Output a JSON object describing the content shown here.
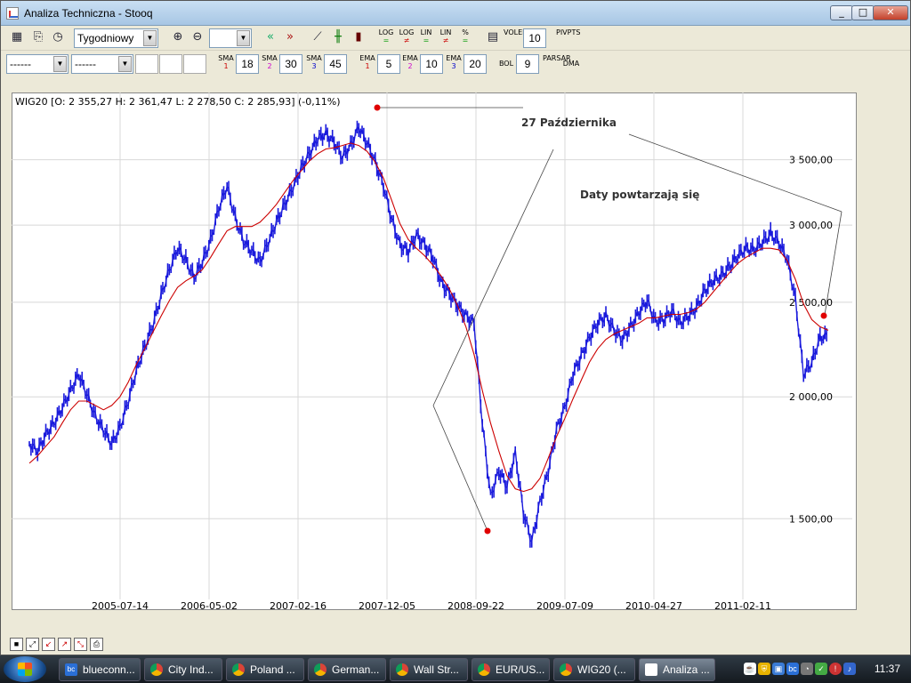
{
  "window": {
    "title": "Analiza Techniczna - Stooq",
    "min": "_",
    "max": "□",
    "close": "✕"
  },
  "toolbar1": {
    "interval": "Tygodniowy",
    "zoom_value": "",
    "vol_ema_label": [
      "VOL",
      "EMA"
    ],
    "vol_ema_value": "10",
    "piv_label": [
      "PIV",
      "PTS"
    ],
    "log_labels": [
      [
        "LOG",
        "="
      ],
      [
        "LOG",
        "≠"
      ],
      [
        "LIN",
        "="
      ],
      [
        "LIN",
        "≠"
      ],
      [
        "%",
        "="
      ]
    ]
  },
  "toolbar2": {
    "select1": "------",
    "select2": "------",
    "sma": [
      {
        "n": "1",
        "value": "18"
      },
      {
        "n": "2",
        "value": "30"
      },
      {
        "n": "3",
        "value": "45"
      }
    ],
    "ema": [
      {
        "n": "1",
        "value": "5"
      },
      {
        "n": "2",
        "value": "10"
      },
      {
        "n": "3",
        "value": "20"
      }
    ],
    "bol_label": "BOL",
    "bol_value": "9",
    "par_sar": [
      "PAR",
      "SAR"
    ],
    "dma": "DMA"
  },
  "chart_header": "WIG20 [O: 2 355,27  H: 2 361,47  L: 2 278,50  C: 2 285,93] (-0,11%)",
  "annotations": {
    "date_label": "27  Października",
    "note": "Daty powtarzają się"
  },
  "colors": {
    "price": "#1a1adc",
    "sma": "#cc0000",
    "marker": "#e00000",
    "grid": "#d8d8d8"
  },
  "chart_data": {
    "type": "line",
    "title": "WIG20 [O: 2 355,27  H: 2 361,47  L: 2 278,50  C: 2 285,93] (-0,11%)",
    "xlabel": "",
    "ylabel": "",
    "scale": "log",
    "ylim": [
      1240,
      4000
    ],
    "yticks": [
      1500,
      2000,
      2500,
      3000,
      3500
    ],
    "ytick_labels": [
      "1 500,00",
      "2 000,00",
      "2 500,00",
      "3 000,00",
      "3 500,00"
    ],
    "x_ticks": [
      "2005-07-14",
      "2006-05-02",
      "2007-02-16",
      "2007-12-05",
      "2008-09-22",
      "2009-07-09",
      "2010-04-27",
      "2011-02-11"
    ],
    "series": [
      {
        "values": [
          1790,
          1760,
          1830,
          1880,
          1950,
          2030,
          2110,
          2010,
          1910,
          1850,
          1790,
          1860,
          1980,
          2130,
          2250,
          2370,
          2540,
          2700,
          2840,
          2760,
          2650,
          2750,
          2890,
          3120,
          3290,
          3050,
          2890,
          2820,
          2750,
          2880,
          3020,
          3150,
          3280,
          3430,
          3550,
          3680,
          3720,
          3650,
          3520,
          3620,
          3780,
          3640,
          3480,
          3290,
          3040,
          2860,
          2820,
          2930,
          2860,
          2780,
          2620,
          2550,
          2480,
          2420,
          2380,
          1880,
          1580,
          1680,
          1620,
          1750,
          1520,
          1420,
          1560,
          1680,
          1850,
          1950,
          2110,
          2200,
          2300,
          2380,
          2420,
          2340,
          2290,
          2360,
          2440,
          2510,
          2390,
          2400,
          2450,
          2380,
          2420,
          2470,
          2570,
          2630,
          2660,
          2720,
          2790,
          2840,
          2830,
          2880,
          2940,
          2880,
          2770,
          2520,
          2110,
          2170,
          2300,
          2310
        ]
      },
      {
        "values": [
          1710,
          1740,
          1780,
          1820,
          1880,
          1940,
          1980,
          1980,
          1960,
          1940,
          1960,
          2000,
          2070,
          2160,
          2240,
          2330,
          2420,
          2510,
          2590,
          2630,
          2660,
          2700,
          2780,
          2870,
          2960,
          2990,
          2990,
          2990,
          3020,
          3080,
          3150,
          3240,
          3330,
          3410,
          3490,
          3550,
          3590,
          3600,
          3620,
          3640,
          3620,
          3570,
          3480,
          3350,
          3180,
          3010,
          2900,
          2840,
          2790,
          2730,
          2660,
          2580,
          2480,
          2360,
          2210,
          2030,
          1880,
          1760,
          1660,
          1610,
          1600,
          1610,
          1650,
          1730,
          1820,
          1900,
          1990,
          2080,
          2170,
          2240,
          2290,
          2320,
          2340,
          2360,
          2380,
          2410,
          2410,
          2420,
          2430,
          2430,
          2440,
          2460,
          2500,
          2560,
          2620,
          2680,
          2740,
          2780,
          2810,
          2840,
          2840,
          2830,
          2760,
          2640,
          2490,
          2400,
          2360,
          2340
        ]
      }
    ]
  }
}
